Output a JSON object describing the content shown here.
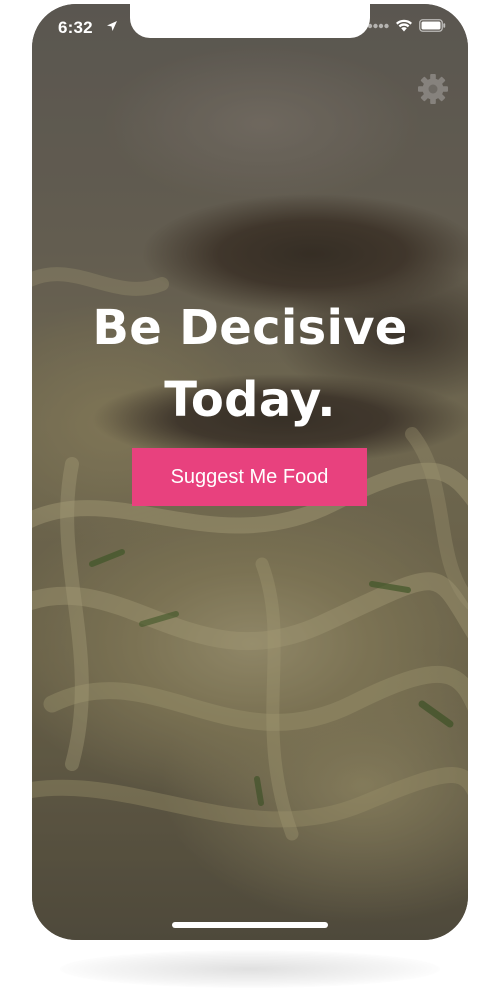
{
  "status_bar": {
    "time": "6:32",
    "location_icon": "location-arrow-icon",
    "signal_icon": "signal-dots-icon",
    "wifi_icon": "wifi-icon",
    "battery_icon": "battery-icon"
  },
  "header": {
    "settings_icon": "gear-icon"
  },
  "hero": {
    "headline_line1": "Be Decisive",
    "headline_line2": "Today.",
    "background": "pasta-with-truffle-photo"
  },
  "cta": {
    "label": "Suggest Me Food"
  },
  "colors": {
    "accent": "#e8417e",
    "text": "#ffffff"
  }
}
